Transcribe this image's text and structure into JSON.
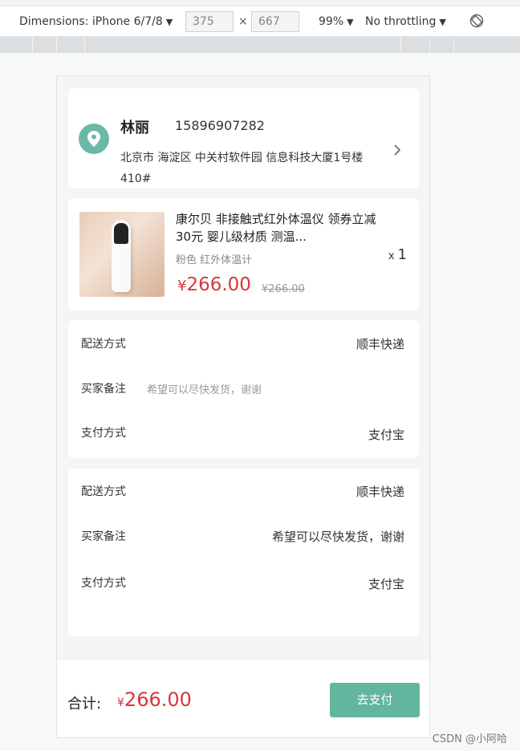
{
  "devtools": {
    "dimensions_label": "Dimensions: iPhone 6/7/8",
    "width": "375",
    "times": "×",
    "height": "667",
    "zoom": "99%",
    "throttling": "No throttling"
  },
  "address": {
    "name": "林丽",
    "phone": "15896907282",
    "detail": "北京市 海淀区 中关村软件园 信息科技大厦1号楼410#"
  },
  "product": {
    "title": "康尔贝 非接触式红外体温仪 领券立减30元 婴儿级材质 测温...",
    "spec": "粉色 红外体温计",
    "qty_prefix": "x",
    "qty": "1",
    "currency": "¥",
    "price": "266.00",
    "old_price": "¥266.00"
  },
  "order_info_1": {
    "delivery_label": "配送方式",
    "delivery_value": "顺丰快递",
    "remark_label": "买家备注",
    "remark_placeholder": "希望可以尽快发货，谢谢",
    "payment_label": "支付方式",
    "payment_value": "支付宝"
  },
  "order_info_2": {
    "delivery_label": "配送方式",
    "delivery_value": "顺丰快递",
    "remark_label": "买家备注",
    "remark_value": "希望可以尽快发货，谢谢",
    "payment_label": "支付方式",
    "payment_value": "支付宝"
  },
  "footer": {
    "total_label": "合计:",
    "currency": "¥",
    "total": "266.00",
    "pay_button": "去支付"
  },
  "watermark": "CSDN @小阿哈",
  "colors": {
    "accent": "#62b59e",
    "price": "#d5373d"
  }
}
